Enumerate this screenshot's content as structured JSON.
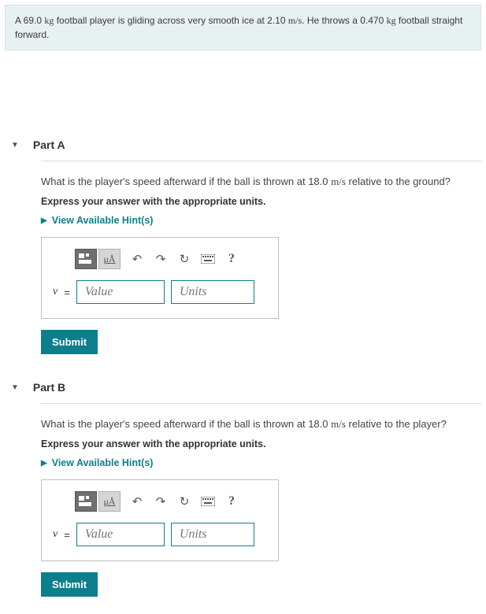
{
  "problem": {
    "prefix": "A 69.0 ",
    "u1": "kg",
    "mid1": " football player is gliding across very smooth ice at 2.10 ",
    "u2": "m/s",
    "mid2": ". He throws a 0.470 ",
    "u3": "kg",
    "suffix": " football straight forward."
  },
  "parts": [
    {
      "title": "Part A",
      "q_prefix": "What is the player's speed afterward if the ball is thrown at 18.0 ",
      "q_unit": "m/s",
      "q_suffix": " relative to the ground?",
      "instruction": "Express your answer with the appropriate units.",
      "hints_label": "View Available Hint(s)",
      "var": "v",
      "eq": "=",
      "value_ph": "Value",
      "units_ph": "Units",
      "submit": "Submit",
      "mu_label": "μÅ",
      "help": "?"
    },
    {
      "title": "Part B",
      "q_prefix": "What is the player's speed afterward if the ball is thrown at 18.0 ",
      "q_unit": "m/s",
      "q_suffix": " relative to the player?",
      "instruction": "Express your answer with the appropriate units.",
      "hints_label": "View Available Hint(s)",
      "var": "v",
      "eq": "=",
      "value_ph": "Value",
      "units_ph": "Units",
      "submit": "Submit",
      "mu_label": "μÅ",
      "help": "?"
    }
  ]
}
